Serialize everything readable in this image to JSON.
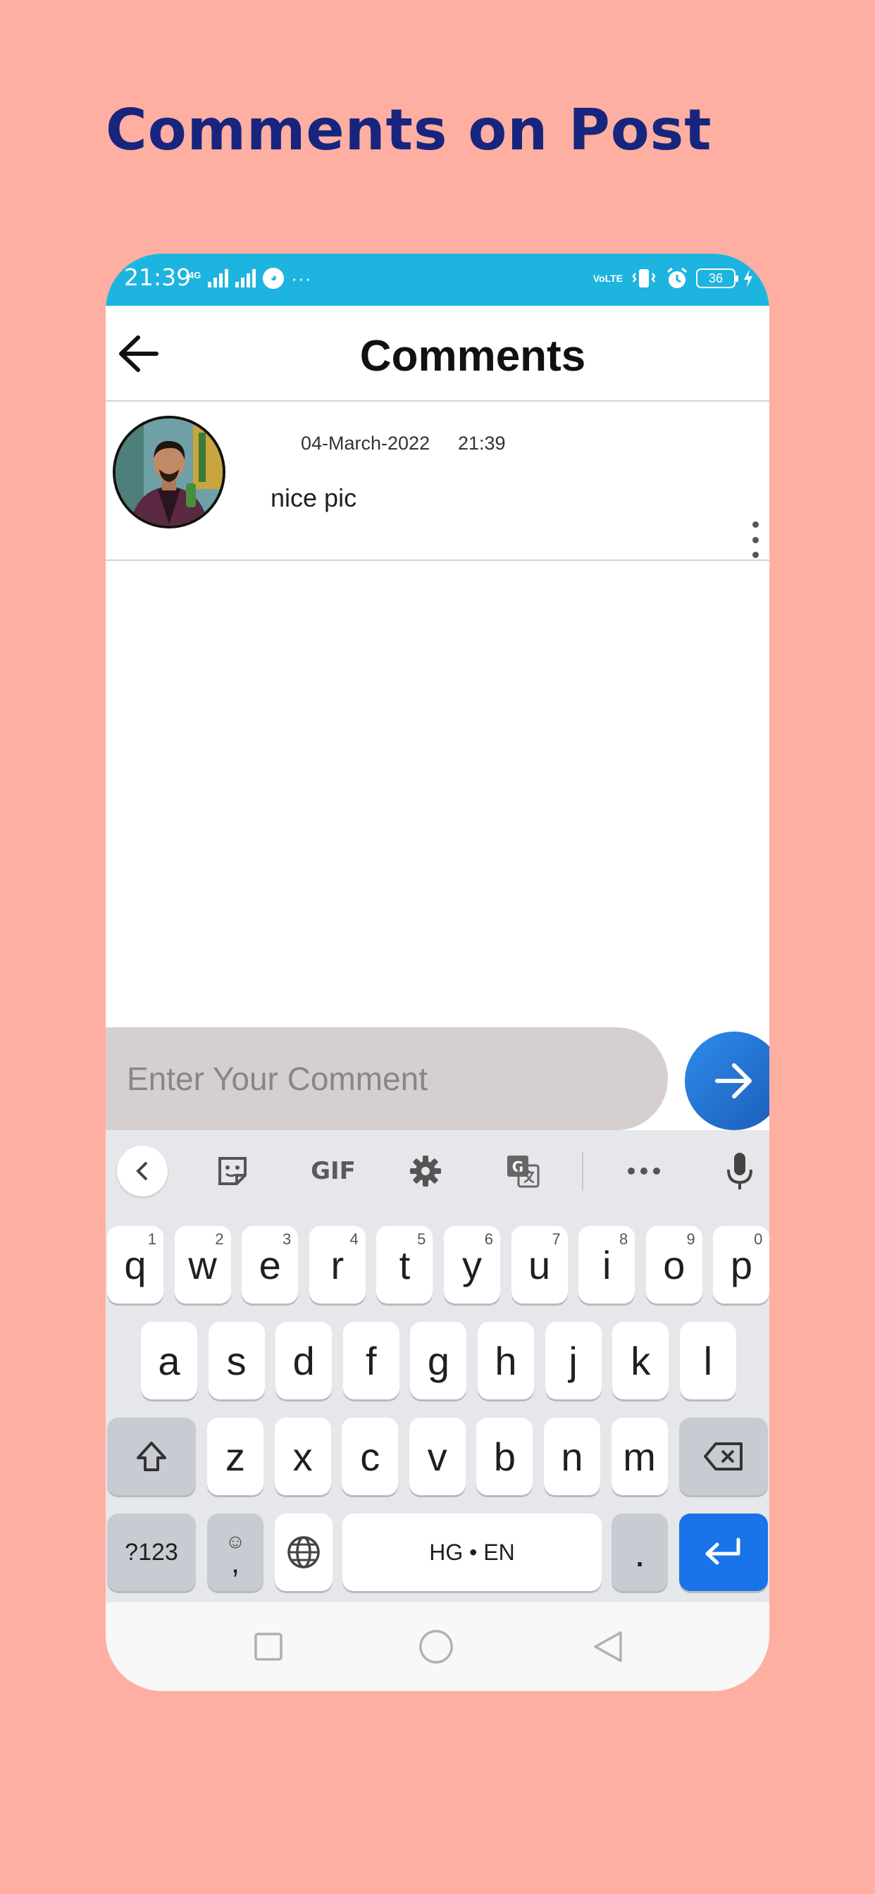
{
  "page": {
    "headline": "Comments on Post",
    "background": "#FFAFA1",
    "headline_color": "#17257E"
  },
  "status_bar": {
    "time": "21:39",
    "network": "4G",
    "volte": "VoLTE",
    "battery": "36",
    "color": "#1EB4E0"
  },
  "app_bar": {
    "title": "Comments"
  },
  "comments": [
    {
      "date": "04-March-2022",
      "time": "21:39",
      "text": "nice pic"
    }
  ],
  "comment_input": {
    "placeholder": "Enter Your Comment",
    "value": ""
  },
  "keyboard": {
    "row1": [
      {
        "key": "q",
        "hint": "1"
      },
      {
        "key": "w",
        "hint": "2"
      },
      {
        "key": "e",
        "hint": "3"
      },
      {
        "key": "r",
        "hint": "4"
      },
      {
        "key": "t",
        "hint": "5"
      },
      {
        "key": "y",
        "hint": "6"
      },
      {
        "key": "u",
        "hint": "7"
      },
      {
        "key": "i",
        "hint": "8"
      },
      {
        "key": "o",
        "hint": "9"
      },
      {
        "key": "p",
        "hint": "0"
      }
    ],
    "row2": [
      "a",
      "s",
      "d",
      "f",
      "g",
      "h",
      "j",
      "k",
      "l"
    ],
    "row3": [
      "z",
      "x",
      "c",
      "v",
      "b",
      "n",
      "m"
    ],
    "toolbar_gif": "GIF",
    "symbols_label": "?123",
    "comma_label": ",",
    "space_label": "HG • EN",
    "period_label": ".",
    "enter_color": "#1A73E8"
  }
}
